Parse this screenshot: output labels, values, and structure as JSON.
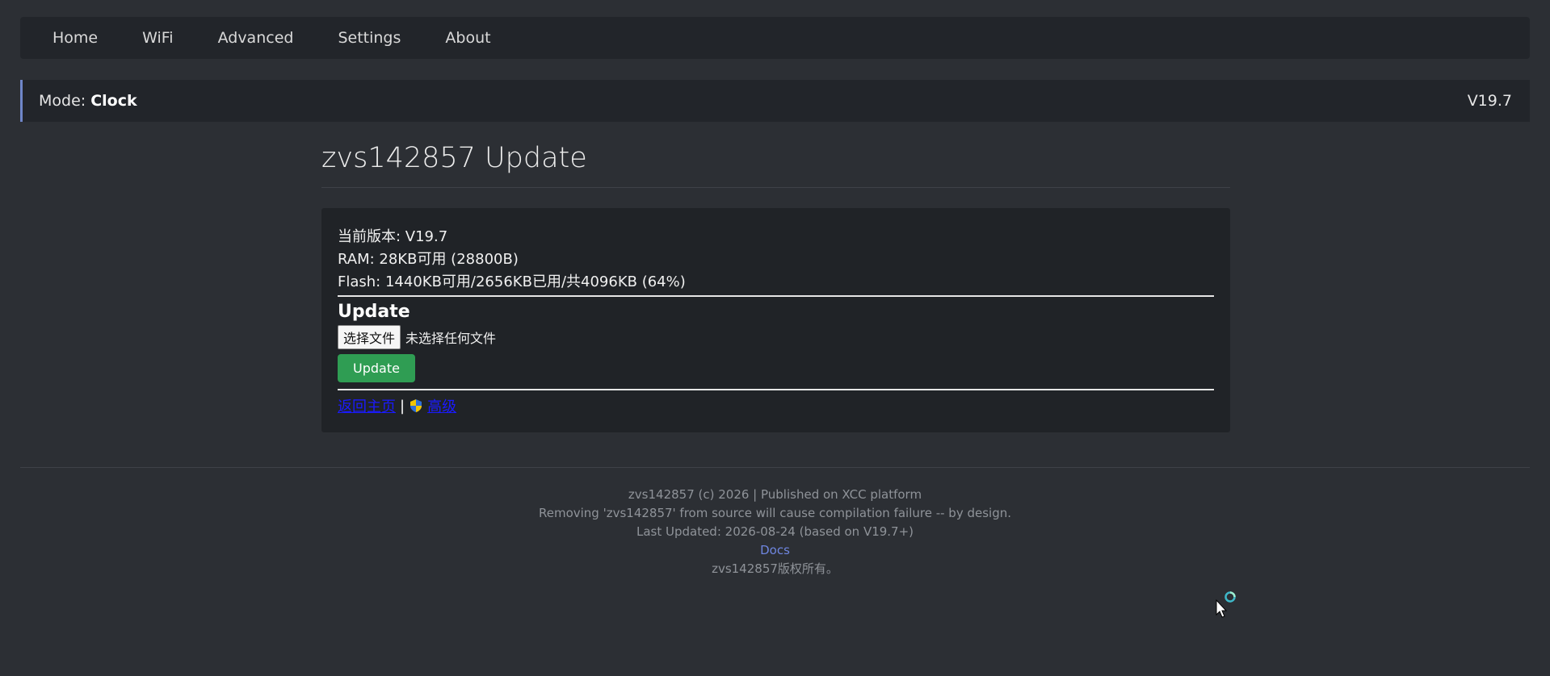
{
  "nav": {
    "items": [
      "Home",
      "WiFi",
      "Advanced",
      "Settings",
      "About"
    ]
  },
  "mode_bar": {
    "mode_label": "Mode: ",
    "mode_value": "Clock",
    "version": "V19.7"
  },
  "main": {
    "title": "zvs142857 Update",
    "info": {
      "current_version": "当前版本: V19.7",
      "ram": "RAM: 28KB可用 (28800B)",
      "flash": "Flash: 1440KB可用/2656KB已用/共4096KB (64%)"
    },
    "update_section": {
      "heading": "Update",
      "choose_file_label": "选择文件",
      "no_file_text": "未选择任何文件",
      "update_button": "Update"
    },
    "links": {
      "back_home": "返回主页",
      "separator": "|",
      "advanced": "高级"
    }
  },
  "footer": {
    "line1": "zvs142857 (c) 2026 | Published on XCC platform",
    "line2": "Removing 'zvs142857' from source will cause compilation failure -- by design.",
    "line3": "Last Updated: 2026-08-24 (based on V19.7+)",
    "docs_link": "Docs",
    "copyright": "zvs142857版权所有。"
  },
  "colors": {
    "background": "#2c2f34",
    "panel": "#22252a",
    "accent_border": "#6f86c9",
    "update_button": "#2f9d53",
    "link": "#1a1aff",
    "footer_link": "#6f86e0"
  },
  "icons": [
    "shield-icon",
    "cursor-icon",
    "busy-spinner-icon"
  ]
}
